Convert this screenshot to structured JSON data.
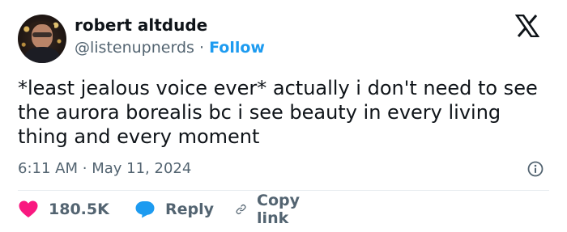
{
  "author": {
    "name": "robert altdude",
    "handle": "@listenupnerds",
    "separator": "·",
    "follow_label": "Follow"
  },
  "tweet": {
    "text": "*least jealous voice ever* actually i don't need to see the aurora borealis bc i see beauty in every living thing and every moment",
    "time": "6:11 AM",
    "date": "May 11, 2024"
  },
  "actions": {
    "likes": "180.5K",
    "reply_label": "Reply",
    "copy_label": "Copy link"
  },
  "colors": {
    "like": "#f91880",
    "reply": "#1d9bf0",
    "link": "#1d9bf0",
    "muted": "#536471"
  }
}
